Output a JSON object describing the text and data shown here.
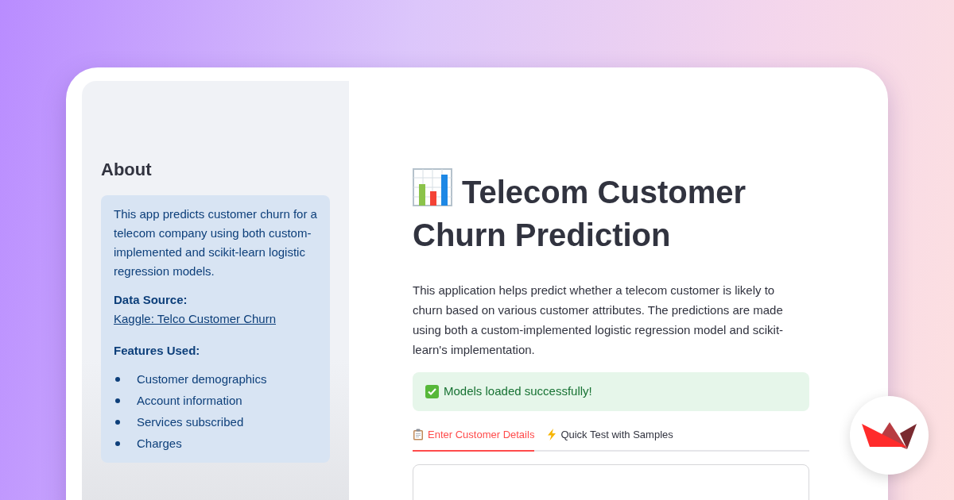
{
  "sidebar": {
    "heading": "About",
    "info": {
      "description": "This app predicts customer churn for a telecom company using both custom-implemented and scikit-learn logistic regression models.",
      "source_label": "Data Source:",
      "source_link": "Kaggle: Telco Customer Churn",
      "features_heading": "Features Used:",
      "features": [
        "Customer demographics",
        "Account information",
        "Services subscribed",
        "Charges"
      ]
    }
  },
  "main": {
    "title": "Telecom Customer Churn Prediction",
    "intro": "This application helps predict whether a telecom customer is likely to churn based on various customer attributes. The predictions are made using both a custom-implemented logistic regression model and scikit-learn's implementation.",
    "alert": "Models loaded successfully!",
    "tabs": [
      {
        "label": "Enter Customer Details",
        "selected": true
      },
      {
        "label": "Quick Test with Samples",
        "selected": false
      }
    ]
  }
}
